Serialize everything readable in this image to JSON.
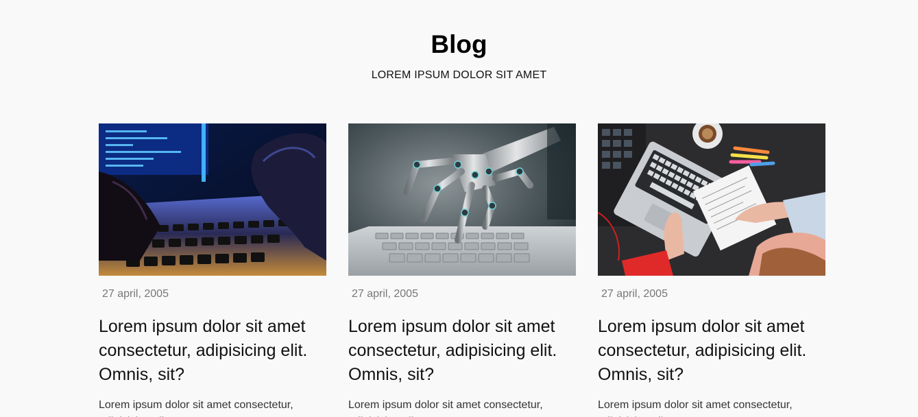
{
  "header": {
    "title": "Blog",
    "subtitle": "LOREM IPSUM DOLOR SIT AMET"
  },
  "posts": [
    {
      "image": "hacker-gloved-hands-typing-on-laptop",
      "date": "27 april, 2005",
      "title": "Lorem ipsum dolor sit amet consectetur, adipisicing elit. Omnis, sit?",
      "excerpt": "Lorem ipsum dolor sit amet consectetur, adipisicing elit. Ca"
    },
    {
      "image": "robot-hand-touching-laptop-keyboard",
      "date": "27 april, 2005",
      "title": "Lorem ipsum dolor sit amet consectetur, adipisicing elit. Omnis, sit?",
      "excerpt": "Lorem ipsum dolor sit amet consectetur, adipisicing elit. Ca"
    },
    {
      "image": "desk-top-view-laptop-coffee-notes",
      "date": "27 april, 2005",
      "title": "Lorem ipsum dolor sit amet consectetur, adipisicing elit. Omnis, sit?",
      "excerpt": "Lorem ipsum dolor sit amet consectetur, adipisicing elit. Ca"
    }
  ]
}
